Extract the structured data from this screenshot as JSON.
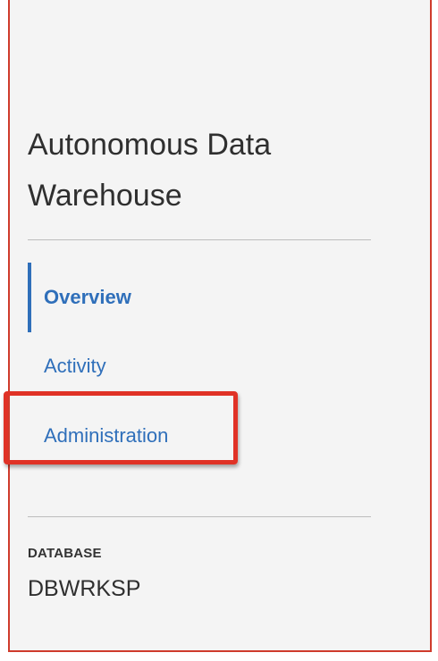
{
  "sidebar": {
    "title_line1": "Autonomous Data",
    "title_line2": "Warehouse",
    "nav_items": [
      {
        "label": "Overview",
        "active": true
      },
      {
        "label": "Activity",
        "active": false
      },
      {
        "label": "Administration",
        "active": false,
        "highlighted": true
      }
    ],
    "database_section_label": "DATABASE",
    "database_name": "DBWRKSP"
  },
  "colors": {
    "link": "#2f6fba",
    "highlight_border": "#e03226",
    "panel_border": "#cf3b2c",
    "panel_background": "#f4f4f4"
  }
}
